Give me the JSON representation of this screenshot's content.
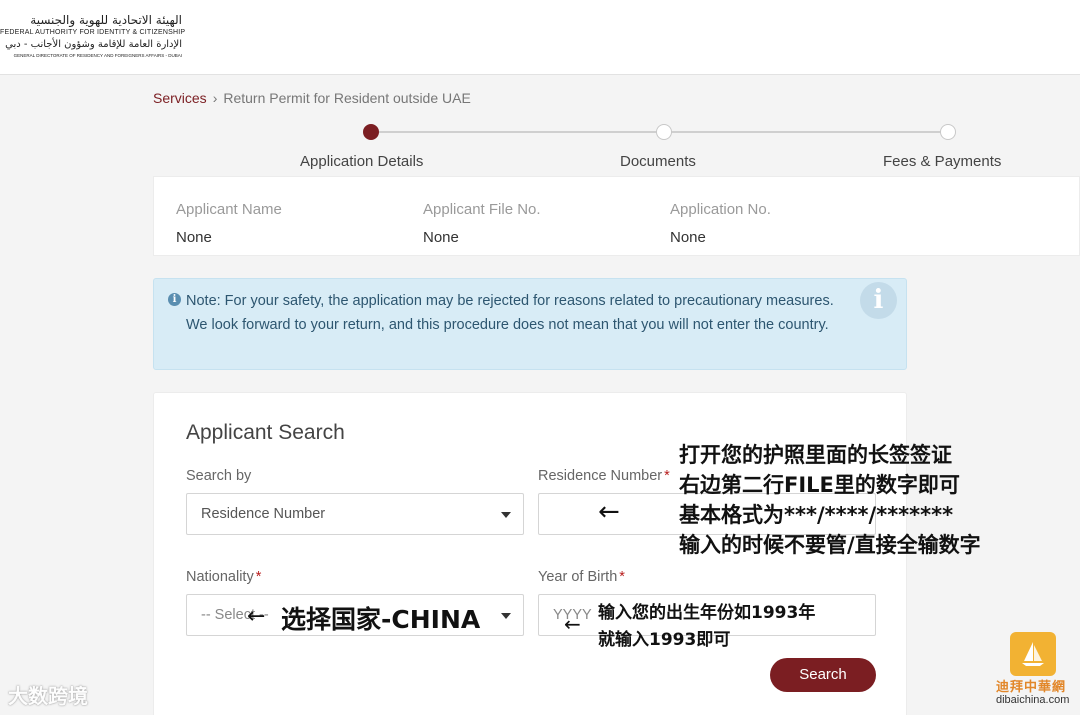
{
  "header": {
    "logo_arabic_line1": "الهيئة الاتحادية للهوية والجنسية",
    "logo_english_line1": "FEDERAL AUTHORITY FOR IDENTITY & CITIZENSHIP",
    "logo_arabic_line2": "الإدارة العامة للإقامة وشؤون الأجانب - دبي",
    "logo_english_line2": "GENERAL DIRECTORATE OF RESIDENCY AND FOREIGNERS AFFAIRS - DUBAI"
  },
  "breadcrumb": {
    "root": "Services",
    "separator": "›",
    "current": "Return Permit for Resident outside UAE"
  },
  "stepper": {
    "steps": [
      {
        "label": "Application Details",
        "active": true
      },
      {
        "label": "Documents",
        "active": false
      },
      {
        "label": "Fees & Payments",
        "active": false
      }
    ]
  },
  "applicant_info": {
    "name_label": "Applicant Name",
    "name_value": "None",
    "file_label": "Applicant File No.",
    "file_value": "None",
    "app_label": "Application No.",
    "app_value": "None"
  },
  "note": {
    "text": "Note: For your safety, the application may be rejected for reasons related to precautionary measures. We look forward to your return, and this procedure does not mean that you will not enter the country.",
    "info_glyph": "i"
  },
  "search": {
    "title": "Applicant Search",
    "search_by_label": "Search by",
    "search_by_value": "Residence Number",
    "residence_label": "Residence Number",
    "residence_value": "",
    "nationality_label": "Nationality",
    "nationality_placeholder": "-- Select --",
    "year_label": "Year of Birth",
    "year_placeholder": "YYYY",
    "required_mark": "*",
    "search_button": "Search"
  },
  "annotations": {
    "residence_tip_line1": "打开您的护照里面的长签签证",
    "residence_tip_line2": "右边第二行FILE里的数字即可",
    "residence_tip_line3": "基本格式为***/****/*******",
    "residence_tip_line4": "输入的时候不要管/直接全输数字",
    "nationality_tip": "选择国家-CHINA",
    "year_tip_line1": "输入您的出生年份如1993年",
    "year_tip_line2": "就输入1993即可",
    "arrow": "←"
  },
  "watermarks": {
    "left": "大数跨境",
    "right_cn": "迪拜中華網",
    "right_url": "dibaichina.com"
  },
  "colors": {
    "brand": "#7b1e22",
    "note_bg": "#d8ecf6",
    "page_bg": "#f4f4f4",
    "required": "#b71c1c"
  }
}
